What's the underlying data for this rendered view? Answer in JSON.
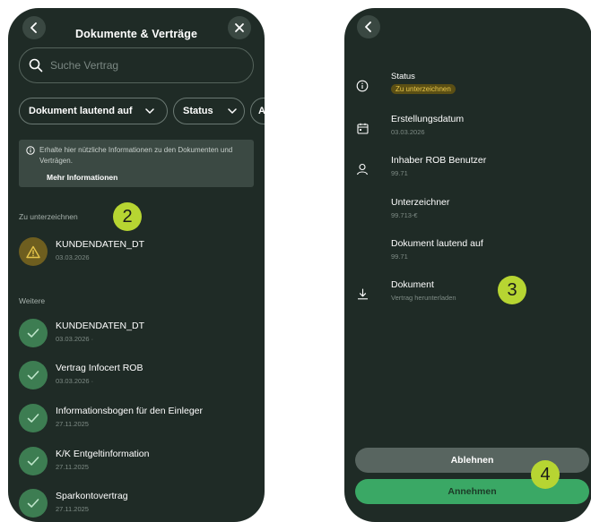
{
  "colors": {
    "background": "#1f2b26",
    "accent_green": "#3aa865",
    "warning": "#e6c54a",
    "step_badge": "#b7d532"
  },
  "left_screen": {
    "title": "Dokumente & Verträge",
    "search_placeholder": "Suche Vertrag",
    "filters": [
      "Dokument lautend auf",
      "Status",
      "A"
    ],
    "info": {
      "text": "Erhalte hier nützliche Informationen zu den Dokumenten und Verträgen.",
      "link": "Mehr Informationen"
    },
    "section_to_sign": "Zu unterzeichnen",
    "to_sign_items": [
      {
        "title": "KUNDENDATEN_DT",
        "date": "03.03.2026",
        "icon": "warning-icon"
      }
    ],
    "section_other": "Weitere",
    "other_items": [
      {
        "title": "KUNDENDATEN_DT",
        "date": "03.03.2026 ·",
        "icon": "check-icon"
      },
      {
        "title": "Vertrag Infocert ROB",
        "date": "03.03.2026 ·",
        "icon": "check-icon"
      },
      {
        "title": "Informationsbogen für den Einleger",
        "date": "27.11.2025",
        "icon": "check-icon"
      },
      {
        "title": "K/K Entgeltinformation",
        "date": "27.11.2025",
        "icon": "check-icon"
      },
      {
        "title": "Sparkontovertrag",
        "date": "27.11.2025",
        "icon": "check-icon"
      }
    ]
  },
  "right_screen": {
    "status": {
      "label": "Status",
      "value": "Zu unterzeichnen"
    },
    "rows": [
      {
        "label": "Erstellungsdatum",
        "value": "03.03.2026",
        "icon": "calendar-icon"
      },
      {
        "label": "Inhaber ROB Benutzer",
        "value": "99.71",
        "icon": "person-icon"
      },
      {
        "label": "Unterzeichner",
        "value": "99.713-€",
        "icon": ""
      },
      {
        "label": "Dokument lautend auf",
        "value": "99.71",
        "icon": ""
      },
      {
        "label": "Dokument",
        "value": "Vertrag herunterladen",
        "icon": "download-icon"
      }
    ],
    "reject_label": "Ablehnen",
    "accept_label": "Annehmen"
  },
  "step_badges": [
    "2",
    "3",
    "4"
  ]
}
